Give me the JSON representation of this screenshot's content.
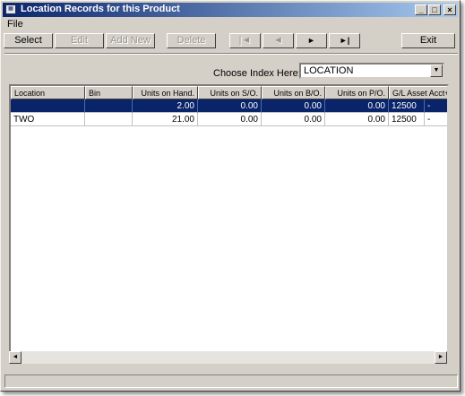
{
  "window": {
    "title": "Location Records for this Product"
  },
  "menu": {
    "file": "File"
  },
  "toolbar": {
    "select": "Select",
    "edit": "Edit",
    "add_new": "Add New",
    "delete": "Delete",
    "first": "|◄",
    "prev": "◄",
    "next": "►",
    "last": "►|",
    "exit": "Exit"
  },
  "index": {
    "label": "Choose Index Here:",
    "value": "LOCATION"
  },
  "table": {
    "columns": [
      "Location",
      "Bin",
      "Units on Hand.",
      "Units on S/O.",
      "Units on B/O.",
      "Units on P/O.",
      "G/L Asset Acct+Dept"
    ],
    "rows": [
      [
        "",
        "",
        "2.00",
        "0.00",
        "0.00",
        "0.00",
        "12500",
        "-"
      ],
      [
        "TWO",
        "",
        "21.00",
        "0.00",
        "0.00",
        "0.00",
        "12500",
        "-"
      ]
    ]
  }
}
